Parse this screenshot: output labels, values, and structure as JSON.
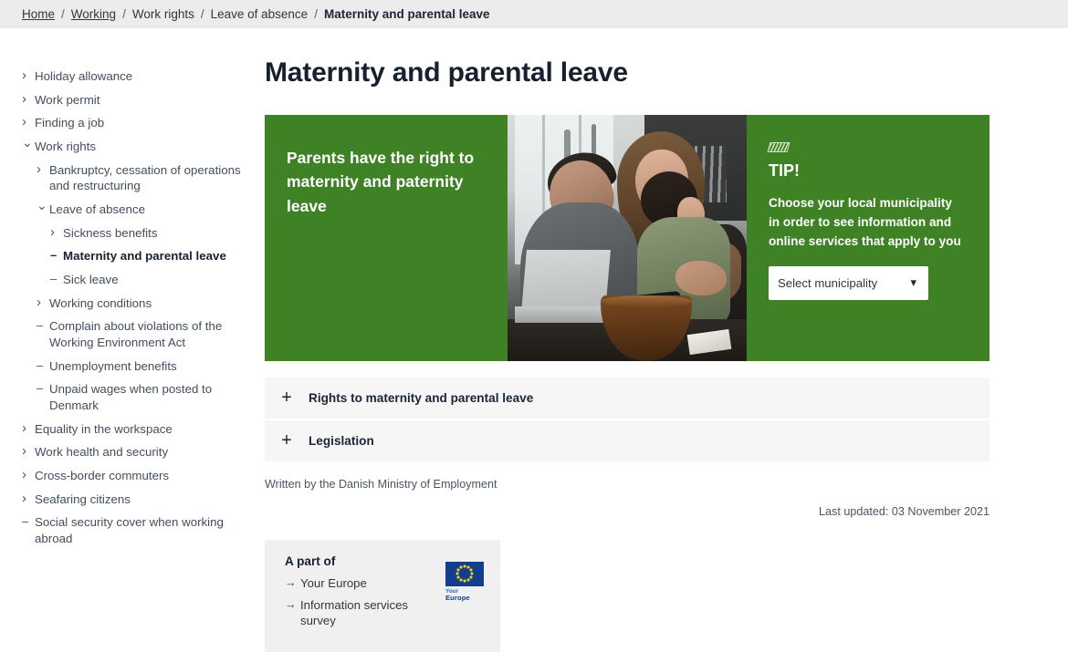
{
  "breadcrumb": {
    "separator": "/",
    "items": [
      {
        "label": "Home",
        "style": "link"
      },
      {
        "label": "Working",
        "style": "link"
      },
      {
        "label": "Work rights",
        "style": "plain"
      },
      {
        "label": "Leave of absence",
        "style": "plain"
      },
      {
        "label": "Maternity and parental leave",
        "style": "current"
      }
    ]
  },
  "sidebar": {
    "items": [
      {
        "label": "Holiday allowance",
        "marker": "chevron-right-icon",
        "level": 0,
        "active": false
      },
      {
        "label": "Work permit",
        "marker": "chevron-right-icon",
        "level": 0,
        "active": false
      },
      {
        "label": "Finding a job",
        "marker": "chevron-right-icon",
        "level": 0,
        "active": false
      },
      {
        "label": "Work rights",
        "marker": "chevron-down-icon",
        "level": 0,
        "active": false
      },
      {
        "label": "Bankruptcy, cessation of operations and restructuring",
        "marker": "chevron-right-icon",
        "level": 1,
        "active": false
      },
      {
        "label": "Leave of absence",
        "marker": "chevron-down-icon",
        "level": 1,
        "active": false
      },
      {
        "label": "Sickness benefits",
        "marker": "chevron-right-icon",
        "level": 2,
        "active": false
      },
      {
        "label": "Maternity and parental leave",
        "marker": "dash-icon",
        "level": 2,
        "active": true
      },
      {
        "label": "Sick leave",
        "marker": "dash-icon",
        "level": 2,
        "active": false
      },
      {
        "label": "Working conditions",
        "marker": "chevron-right-icon",
        "level": 1,
        "active": false
      },
      {
        "label": "Complain about violations of the Working Environment Act",
        "marker": "dash-icon",
        "level": 1,
        "active": false
      },
      {
        "label": "Unemployment benefits",
        "marker": "dash-icon",
        "level": 1,
        "active": false
      },
      {
        "label": "Unpaid wages when posted to Denmark",
        "marker": "dash-icon",
        "level": 1,
        "active": false
      },
      {
        "label": "Equality in the workspace",
        "marker": "chevron-right-icon",
        "level": 0,
        "active": false
      },
      {
        "label": "Work health and security",
        "marker": "chevron-right-icon",
        "level": 0,
        "active": false
      },
      {
        "label": "Cross-border commuters",
        "marker": "chevron-right-icon",
        "level": 0,
        "active": false
      },
      {
        "label": "Seafaring citizens",
        "marker": "chevron-right-icon",
        "level": 0,
        "active": false
      },
      {
        "label": "Social security cover when working abroad",
        "marker": "dash-icon",
        "level": 0,
        "active": false
      }
    ]
  },
  "main": {
    "page_title": "Maternity and parental leave",
    "banner": {
      "background_color": "#3f8226",
      "headline": "Parents have the right to maternity and paternity leave",
      "photo_alt": "Family with a child looking at a laptop in a kitchen",
      "tip": {
        "icon": "tip-hatched-icon",
        "title": "TIP!",
        "text": "Choose your local municipality in order to see information and online services that apply to you",
        "select_value": "Select municipality",
        "select_options": [
          "Select municipality"
        ]
      }
    },
    "accordions": [
      {
        "icon": "plus-icon",
        "label": "Rights to maternity and parental leave"
      },
      {
        "icon": "plus-icon",
        "label": "Legislation"
      }
    ],
    "written_by": "Written by the Danish Ministry of Employment",
    "last_updated": "Last updated: 03 November 2021",
    "apartof": {
      "title": "A part of",
      "links": [
        {
          "icon": "arrow-right-icon",
          "label": "Your Europe"
        },
        {
          "icon": "arrow-right-icon",
          "label": "Information services survey"
        }
      ],
      "logo": {
        "name": "your-europe-logo",
        "word_line1": "Your",
        "word_line2": "Europe",
        "flag_color": "#133d8d",
        "star_color": "#f5d617"
      }
    }
  }
}
